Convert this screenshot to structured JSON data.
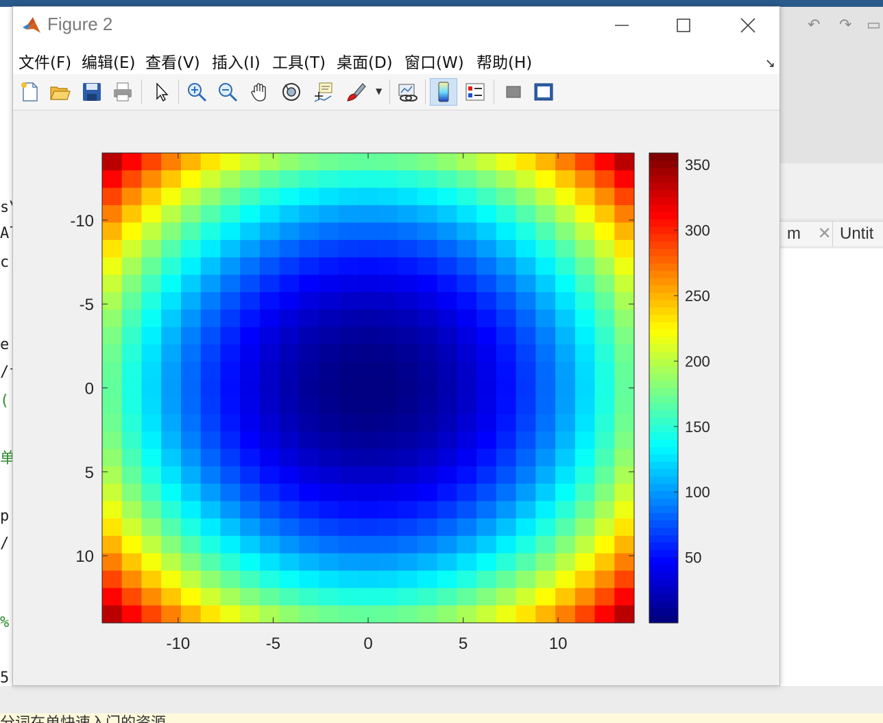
{
  "window": {
    "title": "Figure 2",
    "menu": [
      "文件(F)",
      "编辑(E)",
      "查看(V)",
      "插入(I)",
      "工具(T)",
      "桌面(D)",
      "窗口(W)",
      "帮助(H)"
    ]
  },
  "toolbar": {
    "icons": [
      "new-figure-icon",
      "open-file-icon",
      "save-icon",
      "print-icon",
      "pointer-icon",
      "zoom-in-icon",
      "zoom-out-icon",
      "pan-icon",
      "rotate-3d-icon",
      "data-cursor-icon",
      "brush-icon",
      "link-plot-icon",
      "colorbar-icon",
      "legend-icon",
      "hide-plot-tools-icon",
      "show-plot-tools-icon"
    ],
    "active": "colorbar-icon"
  },
  "background": {
    "right_tabs": [
      "m",
      "Untit"
    ],
    "left_fragments": [
      "s\\",
      "Al",
      "c",
      "e",
      "/f",
      "(",
      "单",
      "p",
      "/",
      "%",
      "5"
    ],
    "bottom_text": "分词在单快速入门的资源"
  },
  "chart_data": {
    "type": "heatmap",
    "colormap": "jet",
    "x_ticks": [
      -10,
      -5,
      0,
      5,
      10
    ],
    "y_ticks": [
      -10,
      -5,
      0,
      5,
      10
    ],
    "y_reversed": true,
    "xlim": [
      -14,
      14
    ],
    "ylim": [
      -14,
      14
    ],
    "grid_size": 27,
    "value_rule": "(x^2 + y^2) mod 360 for integer x, y in [-13, 13]",
    "colorbar": {
      "ticks": [
        50,
        100,
        150,
        200,
        250,
        300,
        350
      ],
      "range": [
        0,
        359
      ]
    }
  }
}
